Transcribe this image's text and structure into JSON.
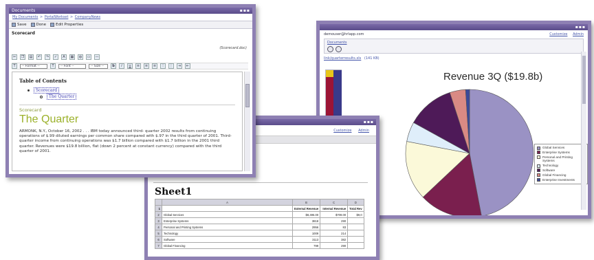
{
  "portal_window": {
    "user_email": "demouser@hrlapp.com",
    "links": [
      "Customize",
      "Admin"
    ],
    "breadcrumb": "Documents",
    "file_link": "link/quarterresults.xls",
    "file_size": "(141 KB)",
    "chart_title": "Revenue 3Q ($19.8b)"
  },
  "chart_data": {
    "type": "pie",
    "title": "Revenue 3Q ($19.8b)",
    "legend_position": "right",
    "slices": [
      {
        "label": "Global Services",
        "value": 47,
        "color": "#9a92c4"
      },
      {
        "label": "Enterprise Systems",
        "value": 16,
        "color": "#7a1f4e"
      },
      {
        "label": "Personal and Printing Systems",
        "value": 15,
        "color": "#fbf9d9"
      },
      {
        "label": "Technology",
        "value": 5,
        "color": "#dfeefa"
      },
      {
        "label": "Software",
        "value": 12,
        "color": "#4e1a58"
      },
      {
        "label": "Global Financing",
        "value": 4,
        "color": "#d98a84"
      },
      {
        "label": "Enterprise Investments",
        "value": 1,
        "color": "#3b4a9a"
      }
    ]
  },
  "sheet_window": {
    "links": [
      "Customize",
      "Admin"
    ],
    "title": "Sheet1",
    "columns": [
      "A",
      "B",
      "C",
      "D"
    ],
    "header_cells": [
      "",
      "External Revenue",
      "Internal Revenue",
      "Total Rev"
    ],
    "rows": [
      {
        "n": "1",
        "cells": [
          "",
          "External Revenue",
          "Internal Revenue",
          "Total Rev"
        ]
      },
      {
        "n": "2",
        "cells": [
          "Global Services",
          "$8,495.00",
          "$709.00",
          "$9,0"
        ]
      },
      {
        "n": "3",
        "cells": [
          "Enterprise Systems",
          "3818",
          "290",
          ""
        ]
      },
      {
        "n": "4",
        "cells": [
          "Personal and Printing Systems",
          "2956",
          "83",
          ""
        ]
      },
      {
        "n": "5",
        "cells": [
          "Technology",
          "1009",
          "214",
          ""
        ]
      },
      {
        "n": "6",
        "cells": [
          "Software",
          "3113",
          "382",
          ""
        ]
      },
      {
        "n": "7",
        "cells": [
          "Global Financing",
          "799",
          "290",
          ""
        ]
      }
    ]
  },
  "doc_window": {
    "title": "Documents",
    "breadcrumb": [
      "My Documents",
      "PortalWorkset",
      "CompanyNews"
    ],
    "buttons": [
      "Save",
      "Done",
      "Edit Properties"
    ],
    "doc_name": "Scorecard",
    "file_name": "(Scorecard.doc)",
    "format_select": "-- Format --",
    "font_select": "-- Font --",
    "size_select": "-- Size --",
    "toc_title": "Table of Contents",
    "toc_item": "Scorecard",
    "toc_subitem": "The Quarter",
    "section_label": "Scorecard",
    "section_heading": "The Quarter",
    "body_text": "ARMONK, N.Y., October 16, 2002 . . . IBM today announced third- quarter 2002 results from continuing operations of $.99 diluted earnings per common share compared with $.97 in the third quarter of 2001. Third-quarter income from continuing operations was $1.7 billion compared with $1.7 billion in the 2001 third quarter. Revenues were $19.8 billion, flat (down 2 percent at constant currency) compared with the third quarter of 2001."
  }
}
